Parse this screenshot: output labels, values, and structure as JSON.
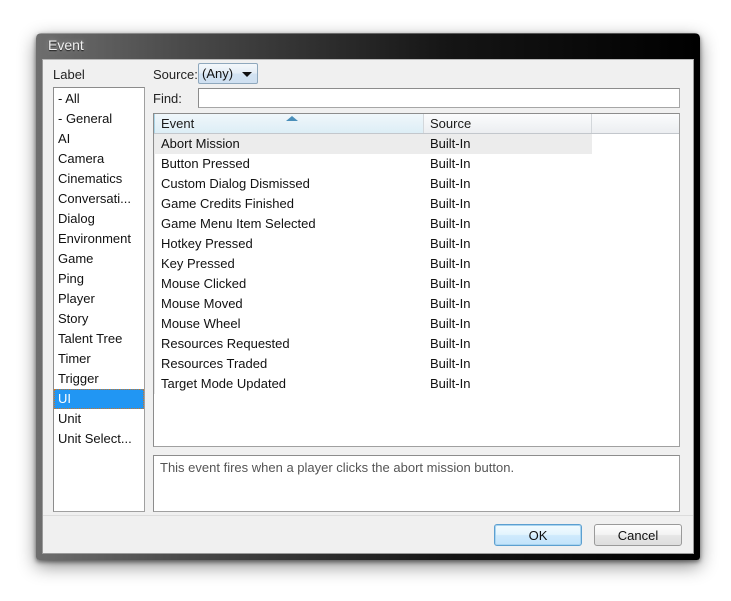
{
  "window": {
    "title": "Event"
  },
  "left_panel": {
    "header": "Label",
    "items": [
      {
        "label": "- All",
        "selected": false
      },
      {
        "label": "- General",
        "selected": false
      },
      {
        "label": "AI",
        "selected": false
      },
      {
        "label": "Camera",
        "selected": false
      },
      {
        "label": "Cinematics",
        "selected": false
      },
      {
        "label": "Conversati...",
        "selected": false
      },
      {
        "label": "Dialog",
        "selected": false
      },
      {
        "label": "Environment",
        "selected": false
      },
      {
        "label": "Game",
        "selected": false
      },
      {
        "label": "Ping",
        "selected": false
      },
      {
        "label": "Player",
        "selected": false
      },
      {
        "label": "Story",
        "selected": false
      },
      {
        "label": "Talent Tree",
        "selected": false
      },
      {
        "label": "Timer",
        "selected": false
      },
      {
        "label": "Trigger",
        "selected": false
      },
      {
        "label": "UI",
        "selected": true
      },
      {
        "label": "Unit",
        "selected": false
      },
      {
        "label": "Unit Select...",
        "selected": false
      }
    ]
  },
  "filters": {
    "source_label": "Source:",
    "source_value": "(Any)",
    "source_options": [
      "(Any)"
    ],
    "find_label": "Find:",
    "find_value": "",
    "find_placeholder": ""
  },
  "grid": {
    "columns": [
      {
        "label": "Event",
        "sorted": true,
        "sort_direction": "ascending"
      },
      {
        "label": "Source",
        "sorted": false
      },
      {
        "label": "",
        "sorted": false
      }
    ],
    "rows": [
      {
        "event": "Abort Mission",
        "source": "Built-In",
        "selected": true
      },
      {
        "event": "Button Pressed",
        "source": "Built-In",
        "selected": false
      },
      {
        "event": "Custom Dialog Dismissed",
        "source": "Built-In",
        "selected": false
      },
      {
        "event": "Game Credits Finished",
        "source": "Built-In",
        "selected": false
      },
      {
        "event": "Game Menu Item Selected",
        "source": "Built-In",
        "selected": false
      },
      {
        "event": "Hotkey Pressed",
        "source": "Built-In",
        "selected": false
      },
      {
        "event": "Key Pressed",
        "source": "Built-In",
        "selected": false
      },
      {
        "event": "Mouse Clicked",
        "source": "Built-In",
        "selected": false
      },
      {
        "event": "Mouse Moved",
        "source": "Built-In",
        "selected": false
      },
      {
        "event": "Mouse Wheel",
        "source": "Built-In",
        "selected": false
      },
      {
        "event": "Resources Requested",
        "source": "Built-In",
        "selected": false
      },
      {
        "event": "Resources Traded",
        "source": "Built-In",
        "selected": false
      },
      {
        "event": "Target Mode Updated",
        "source": "Built-In",
        "selected": false
      }
    ]
  },
  "description": {
    "text": "This event fires when a player clicks the abort mission button."
  },
  "buttons": {
    "ok": "OK",
    "cancel": "Cancel"
  },
  "colors": {
    "selection_blue": "#2196f3",
    "row_selection_gray": "#ececec",
    "sort_arrow": "#4a8fba",
    "default_button_border": "#5c9fd0"
  }
}
